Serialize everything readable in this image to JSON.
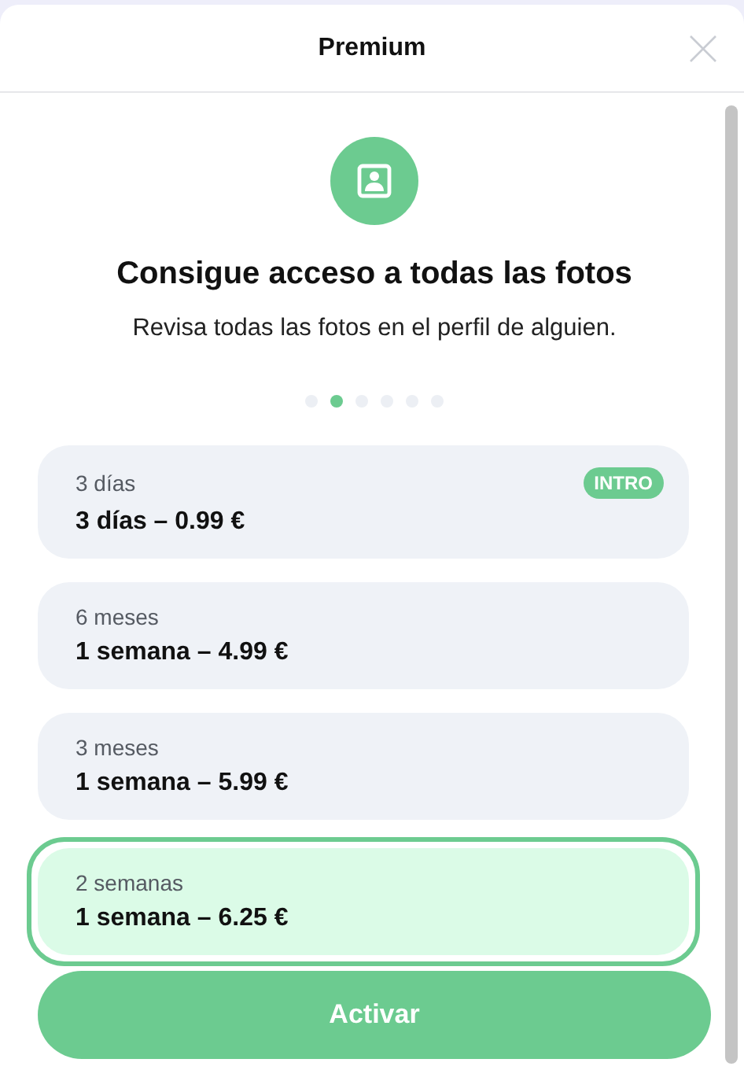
{
  "window": {
    "title": "Premium"
  },
  "feature": {
    "title": "Consigue acceso a todas las fotos",
    "subtitle": "Revisa todas las fotos en el perfil de alguien."
  },
  "dots": [
    {
      "selected": false
    },
    {
      "selected": true
    },
    {
      "selected": false
    },
    {
      "selected": false
    },
    {
      "selected": false
    },
    {
      "selected": false
    }
  ],
  "plans": [
    {
      "name": "3 días",
      "price": "3 días – 0.99 €",
      "badge": "INTRO",
      "selected": false
    },
    {
      "name": "6 meses",
      "price": "1 semana – 4.99 €",
      "selected": false
    },
    {
      "name": "3 meses",
      "price": "1 semana – 5.99 €",
      "selected": false
    },
    {
      "name": "2 semanas",
      "price": "1 semana – 6.25 €",
      "selected": true
    }
  ],
  "button": "Activar"
}
